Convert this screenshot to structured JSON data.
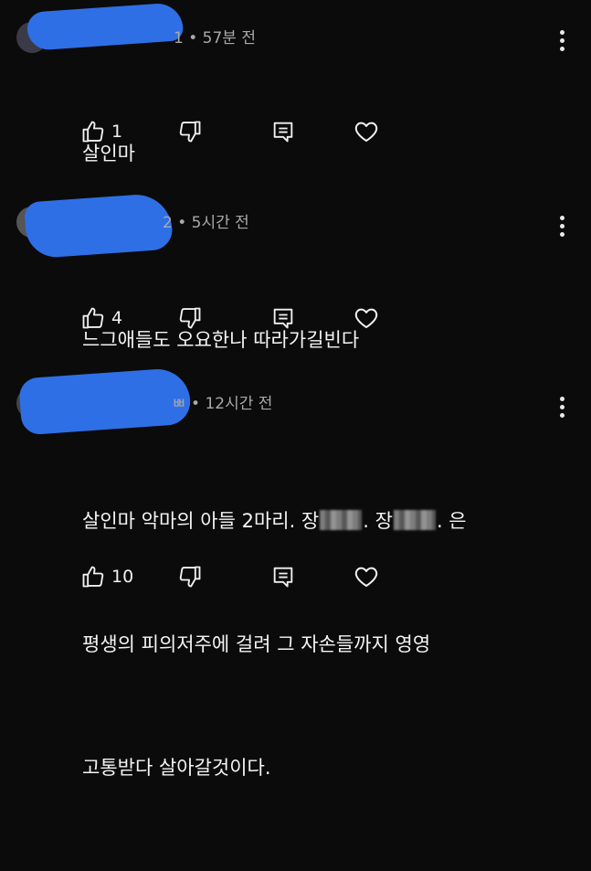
{
  "comments": [
    {
      "name_tail": "1",
      "time": "• 57분 전",
      "text_lines": [
        "살인마"
      ],
      "likes": "1"
    },
    {
      "name_tail": "2",
      "time": "• 5시간 전",
      "text_lines": [
        "느그애들도 오요한나 따라가길빈다"
      ],
      "likes": "4"
    },
    {
      "name_tail": "ㅃ",
      "time": "• 12시간 전",
      "line1_a": "살인마 악마의 아들 2마리. 장",
      "line1_b": ". 장",
      "line1_c": ". 은",
      "line2": "평생의 피의저주에 걸려 그 자손들까지 영영",
      "line3": "고통받다 살아갈것이다.",
      "likes": "10"
    }
  ],
  "icons": {
    "like": "thumbs-up-icon",
    "dislike": "thumbs-down-icon",
    "reply": "reply-icon",
    "heart": "heart-icon",
    "more": "more-vertical-icon"
  },
  "colors": {
    "background": "#0b0b0b",
    "redaction": "#2f6fe6",
    "meta": "#a9a9a9"
  }
}
